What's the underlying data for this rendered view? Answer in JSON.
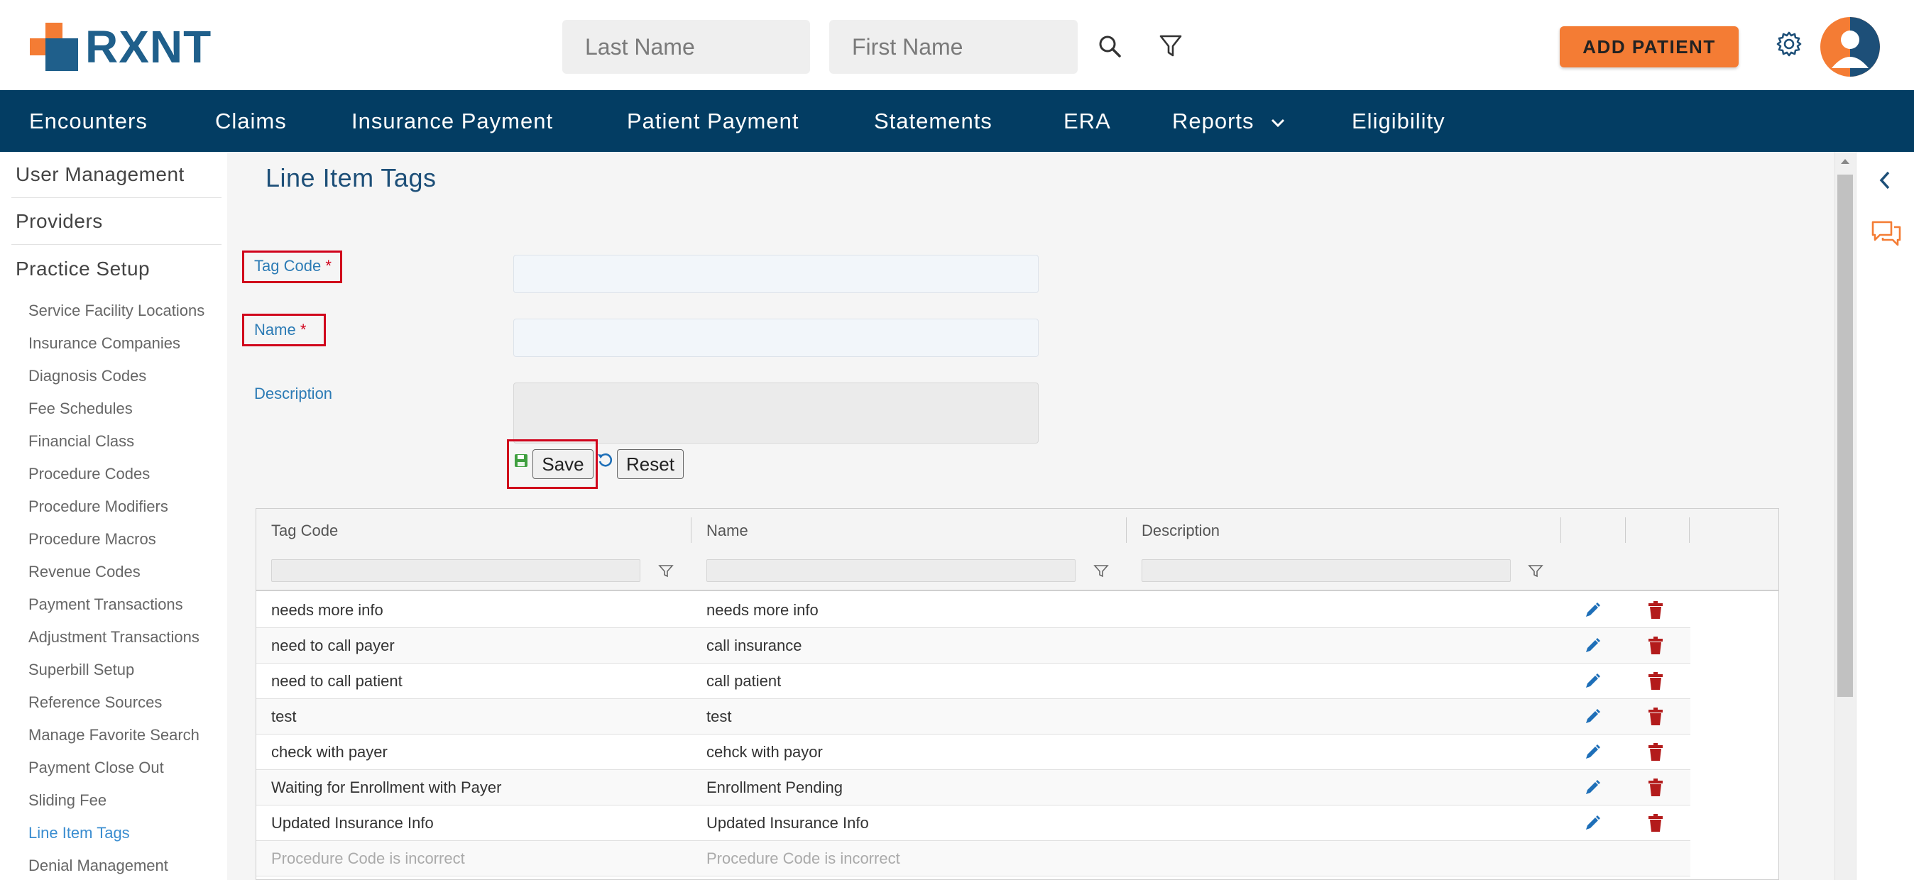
{
  "brand": {
    "logo_text": "RXNT",
    "accent_color": "#f47c34",
    "primary_color": "#033d63"
  },
  "header": {
    "last_name_placeholder": "Last Name",
    "first_name_placeholder": "First Name",
    "add_patient_label": "ADD PATIENT",
    "icons": [
      "search-icon",
      "filter-icon",
      "gear-icon",
      "avatar"
    ]
  },
  "nav": {
    "items": [
      "Encounters",
      "Claims",
      "Insurance Payment",
      "Patient Payment",
      "Statements",
      "ERA",
      "Reports",
      "Eligibility"
    ]
  },
  "sidebar": {
    "sections": [
      "User Management",
      "Providers",
      "Practice Setup"
    ],
    "practice_setup_items": [
      "Service Facility Locations",
      "Insurance Companies",
      "Diagnosis Codes",
      "Fee Schedules",
      "Financial Class",
      "Procedure Codes",
      "Procedure Modifiers",
      "Procedure Macros",
      "Revenue Codes",
      "Payment Transactions",
      "Adjustment Transactions",
      "Superbill Setup",
      "Reference Sources",
      "Manage Favorite Search",
      "Payment Close Out",
      "Sliding Fee",
      "Line Item Tags",
      "Denial Management"
    ],
    "active_item": "Line Item Tags"
  },
  "form": {
    "title": "Line Item Tags",
    "tag_code_label": "Tag Code",
    "name_label": "Name",
    "description_label": "Description",
    "required_marker": "*",
    "tag_code_value": "",
    "name_value": "",
    "description_value": "",
    "save_label": "Save",
    "reset_label": "Reset"
  },
  "grid": {
    "columns": [
      "Tag Code",
      "Name",
      "Description"
    ],
    "rows": [
      {
        "tag_code": "needs more info",
        "name": "needs more info",
        "description": ""
      },
      {
        "tag_code": "need to call payer",
        "name": "call insurance",
        "description": ""
      },
      {
        "tag_code": "need to call patient",
        "name": "call patient",
        "description": ""
      },
      {
        "tag_code": "test",
        "name": "test",
        "description": ""
      },
      {
        "tag_code": "check with payer",
        "name": "cehck with payor",
        "description": ""
      },
      {
        "tag_code": "Waiting for Enrollment with Payer",
        "name": "Enrollment Pending",
        "description": ""
      },
      {
        "tag_code": "Updated Insurance Info",
        "name": "Updated Insurance Info",
        "description": ""
      },
      {
        "tag_code": "Procedure Code is incorrect",
        "name": "Procedure Code is incorrect",
        "description": ""
      }
    ]
  }
}
